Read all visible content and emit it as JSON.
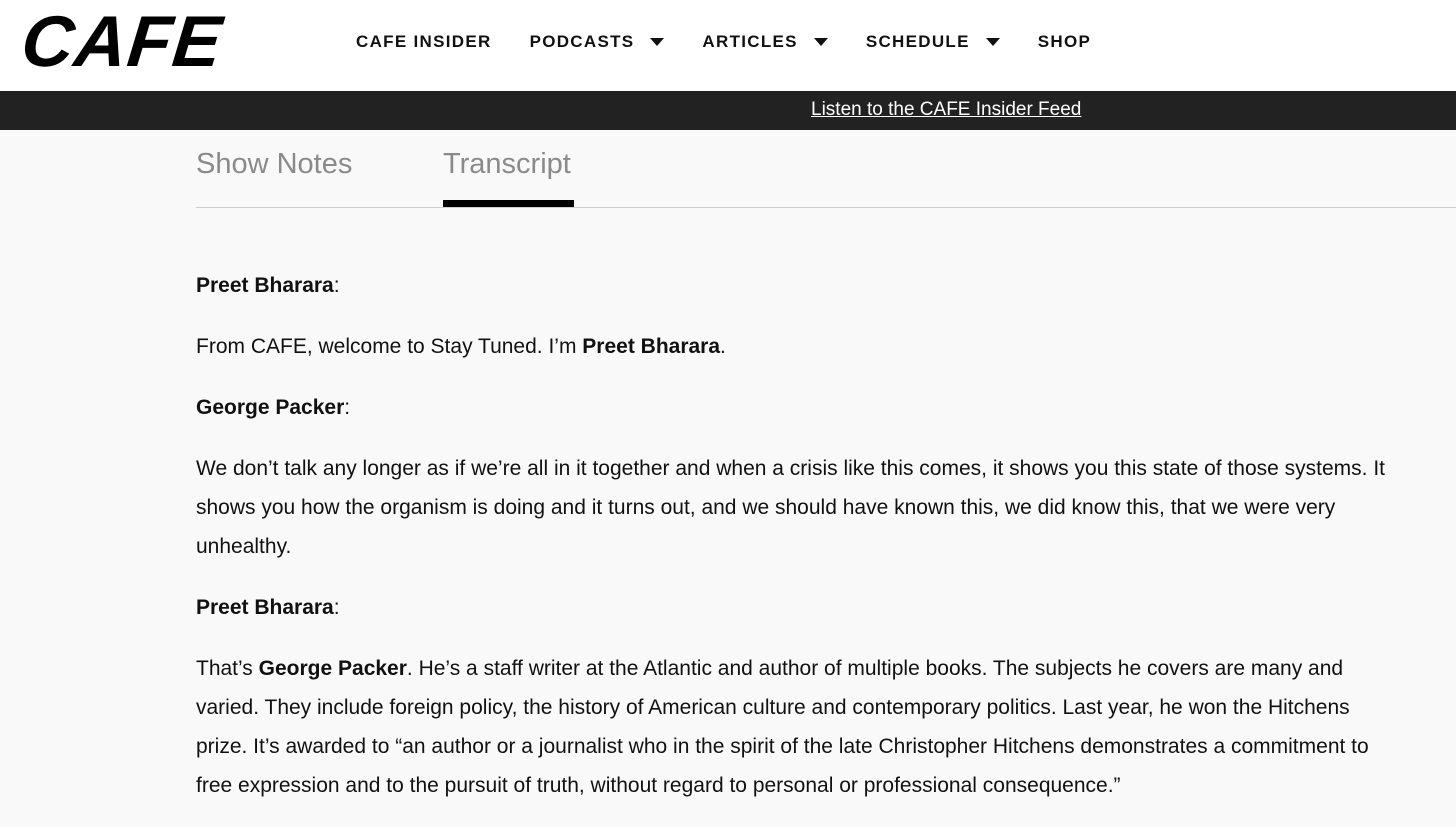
{
  "header": {
    "logo": "CAFE",
    "nav": [
      {
        "label": "CAFE INSIDER",
        "has_dropdown": false
      },
      {
        "label": "PODCASTS",
        "has_dropdown": true
      },
      {
        "label": "ARTICLES",
        "has_dropdown": true
      },
      {
        "label": "SCHEDULE",
        "has_dropdown": true
      },
      {
        "label": "SHOP",
        "has_dropdown": false
      }
    ]
  },
  "banner": {
    "link_text": "Listen to the CAFE Insider Feed"
  },
  "tabs": {
    "items": [
      "Show Notes",
      "Transcript"
    ],
    "active": "Transcript"
  },
  "transcript": {
    "s1_speaker": "Preet Bharara",
    "colon": ":",
    "p1_text_a": "From CAFE, welcome to Stay Tuned. I’m ",
    "p1_bold": "Preet Bharara",
    "p1_text_b": ".",
    "s2_speaker": "George Packer",
    "p2_line1": "We don’t talk any longer as if we’re all in it together and when a crisis like this comes, it shows you this state of those systems. It",
    "p2_line2": "shows you how the organism is doing and it turns out, and we should have known this, we did know this, that we were very",
    "p2_line3": "unhealthy.",
    "s3_speaker": "Preet Bharara",
    "p3_text_a": "That’s ",
    "p3_bold": "George Packer",
    "p3_line1_rest": ". He’s a staff writer at the Atlantic and author of multiple books. The subjects he covers are many and",
    "p3_line2": "varied. They include foreign policy, the history of American culture and contemporary politics. Last year, he won the Hitchens",
    "p3_line3": "prize. It’s awarded to “an author or a journalist who in the spirit of the late Christopher Hitchens demonstrates a commitment to",
    "p3_line4": "free expression and to the pursuit of truth, without regard to personal or professional consequence.”"
  }
}
